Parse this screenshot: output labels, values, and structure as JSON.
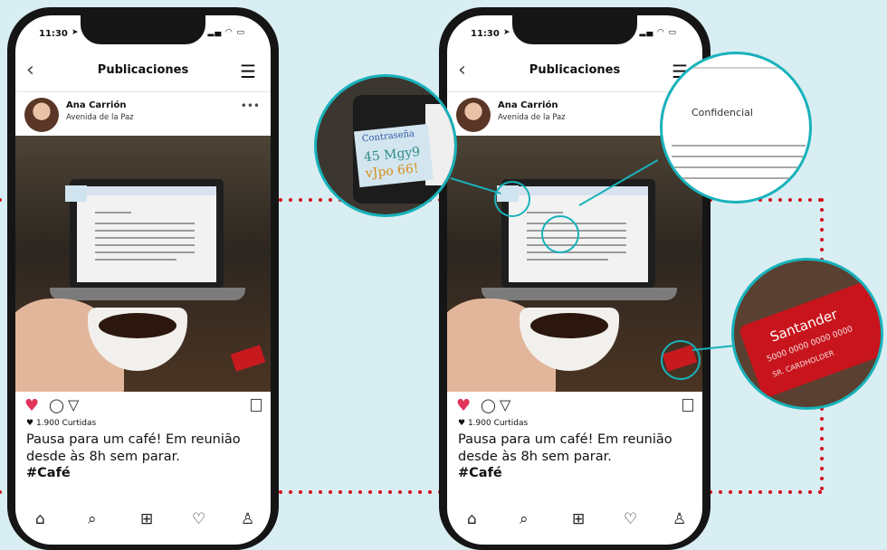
{
  "colors": {
    "background": "#d8eef2",
    "accent_teal": "#18b2bb",
    "dot_red": "#d40f1e",
    "like_pink": "#e2345a"
  },
  "status": {
    "time": "11:30",
    "location_icon": "navigation-arrow-icon",
    "signal_icons": "signal-wifi-battery-icons"
  },
  "header": {
    "title": "Publicaciones",
    "back_icon": "chevron-left-icon",
    "menu_icon": "hamburger-menu-icon"
  },
  "post": {
    "user_name": "Ana Carrión",
    "user_location": "Avenida de la Paz",
    "more_icon": "more-dots-icon",
    "likes_text": "1.900 Curtidas",
    "caption": "Pausa para um café! Em reunião desde às 8h sem parar.",
    "hashtag": "#Café"
  },
  "actions": {
    "like_icon": "heart-filled-icon",
    "comment_icon": "comment-icon",
    "share_icon": "send-icon",
    "save_icon": "bookmark-icon"
  },
  "bottom_nav": [
    "home-icon",
    "search-icon",
    "add-post-icon",
    "heart-icon",
    "profile-icon"
  ],
  "zoom_password": {
    "line1": "Contraseña",
    "line2": "45 Mgy9",
    "line3": "vJpo 66!"
  },
  "zoom_doc": {
    "heading": "Confidencial"
  },
  "zoom_card": {
    "brand": "Santander",
    "number": "5000 0000 0000 0000",
    "holder": "SR. CARDHOLDER"
  }
}
